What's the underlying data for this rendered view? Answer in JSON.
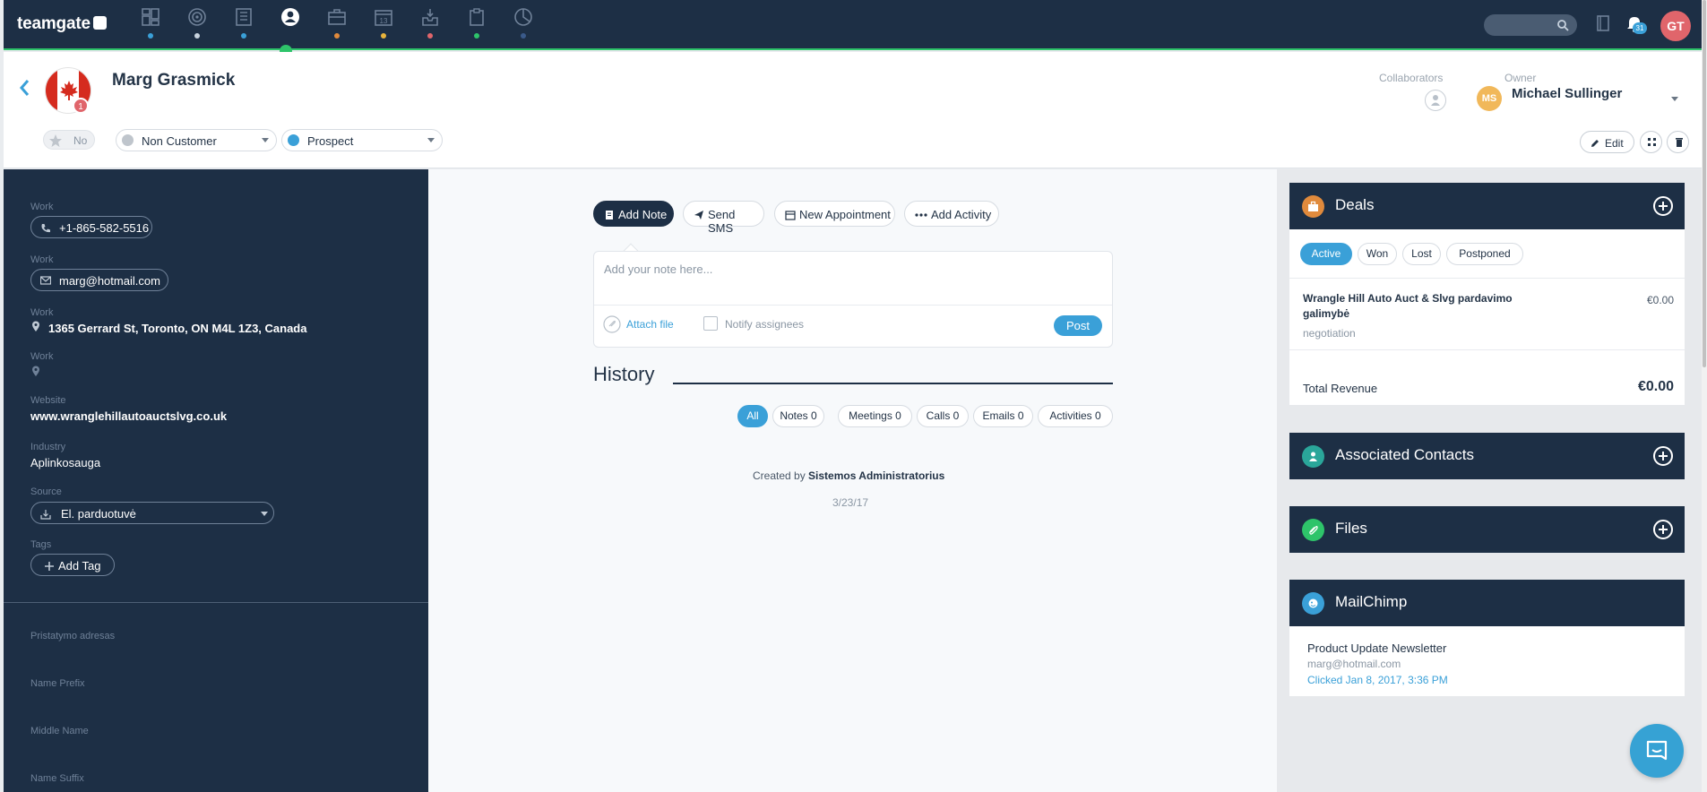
{
  "app": {
    "brand": "teamgate"
  },
  "nav": {
    "items": [
      {
        "name": "dashboard-icon",
        "dot": "#3aa0d8"
      },
      {
        "name": "target-icon",
        "dot": "#c8d3df"
      },
      {
        "name": "company-icon",
        "dot": "#3aa0d8"
      },
      {
        "name": "contact-icon",
        "dot": "#2ec46a"
      },
      {
        "name": "briefcase-icon",
        "dot": "#e08a3c"
      },
      {
        "name": "calendar-icon",
        "dot": "#e8b43c"
      },
      {
        "name": "inbox-icon",
        "dot": "#e0656b"
      },
      {
        "name": "clipboard-icon",
        "dot": "#2ec46a"
      },
      {
        "name": "chart-icon",
        "dot": "#3a5a8a"
      }
    ],
    "calendar_number": "13",
    "notifications_count": "31",
    "user_initials": "GT"
  },
  "contact": {
    "name": "Marg Grasmick",
    "avatar_badge": "1",
    "favorite_label": "No",
    "customer_status": "Non Customer",
    "customer_status_color": "#bfc5cc",
    "lead_status": "Prospect",
    "lead_status_color": "#3aa0d8",
    "collaborators_label": "Collaborators",
    "owner_label": "Owner",
    "owner_initials": "MS",
    "owner_name": "Michael Sullinger",
    "edit_label": "Edit"
  },
  "details": {
    "phone_label": "Work",
    "phone": "+1-865-582-5516",
    "email_label": "Work",
    "email": "marg@hotmail.com",
    "address_label": "Work",
    "address": "1365 Gerrard St, Toronto, ON M4L 1Z3, Canada",
    "address2_label": "Work",
    "website_label": "Website",
    "website": "www.wranglehillautoauctslvg.co.uk",
    "industry_label": "Industry",
    "industry": "Aplinkosauga",
    "source_label": "Source",
    "source": "El. parduotuvė",
    "tags_label": "Tags",
    "add_tag": "Add Tag",
    "extra_fields": [
      "Pristatymo adresas",
      "Name Prefix",
      "Middle Name",
      "Name Suffix"
    ]
  },
  "actions": {
    "add_note": "Add Note",
    "send_sms": "Send SMS",
    "new_appointment": "New Appointment",
    "add_activity": "Add Activity"
  },
  "note": {
    "placeholder": "Add your note here...",
    "attach": "Attach file",
    "notify": "Notify assignees",
    "post": "Post"
  },
  "history": {
    "title": "History",
    "filters": [
      "All",
      "Notes 0",
      "Meetings 0",
      "Calls 0",
      "Emails 0",
      "Activities 0"
    ],
    "created_by_prefix": "Created by",
    "created_by": "Sistemos Administratorius",
    "created_date": "3/23/17"
  },
  "deals": {
    "title": "Deals",
    "tabs": [
      "Active",
      "Won",
      "Lost",
      "Postponed"
    ],
    "item_name": "Wrangle Hill Auto Auct & Slvg pardavimo galimybė",
    "item_stage": "negotiation",
    "item_amount": "€0.00",
    "total_label": "Total Revenue",
    "total_value": "€0.00"
  },
  "associated": {
    "title": "Associated Contacts"
  },
  "files": {
    "title": "Files"
  },
  "mailchimp": {
    "title": "MailChimp",
    "campaign": "Product Update Newsletter",
    "email": "marg@hotmail.com",
    "activity": "Clicked Jan 8, 2017, 3:36 PM"
  },
  "colors": {
    "navy": "#1d2f45",
    "accent": "#3aa0d8",
    "green": "#2ec46a",
    "deals_icon": "#e08a3c",
    "files_icon": "#2ec46a"
  }
}
